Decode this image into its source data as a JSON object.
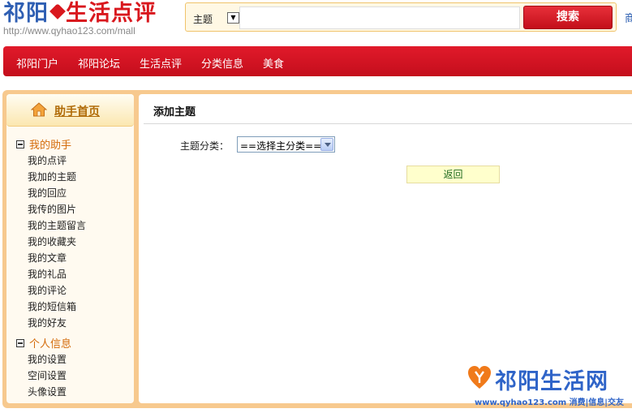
{
  "header": {
    "logo_part1": "祁阳",
    "logo_part2": "生活点评",
    "logo_url": "http://www.qyhao123.com/mall",
    "search_category": "主题",
    "search_value": "",
    "search_button": "搜索",
    "cut_text": "商"
  },
  "nav": {
    "items": [
      "祁阳门户",
      "祁阳论坛",
      "生活点评",
      "分类信息",
      "美食"
    ]
  },
  "sidebar": {
    "home_label": "助手首页",
    "groups": [
      {
        "title": "我的助手",
        "links": [
          "我的点评",
          "我加的主题",
          "我的回应",
          "我传的图片",
          "我的主题留言",
          "我的收藏夹",
          "我的文章",
          "我的礼品",
          "我的评论",
          "我的短信箱",
          "我的好友"
        ]
      },
      {
        "title": "个人信息",
        "links": [
          "我的设置",
          "空间设置",
          "头像设置"
        ]
      }
    ]
  },
  "main": {
    "title": "添加主题",
    "category_label": "主题分类：",
    "category_select": "==选择主分类==",
    "back_button": "返回"
  },
  "brand": {
    "name": "祁阳生活网",
    "tagline": "www.qyhao123.com 消费|信息|交友"
  },
  "colors": {
    "nav_red": "#d9141f",
    "frame_orange": "#f7c98e",
    "link_orange": "#d46c0c",
    "brand_blue": "#2f64c8"
  }
}
